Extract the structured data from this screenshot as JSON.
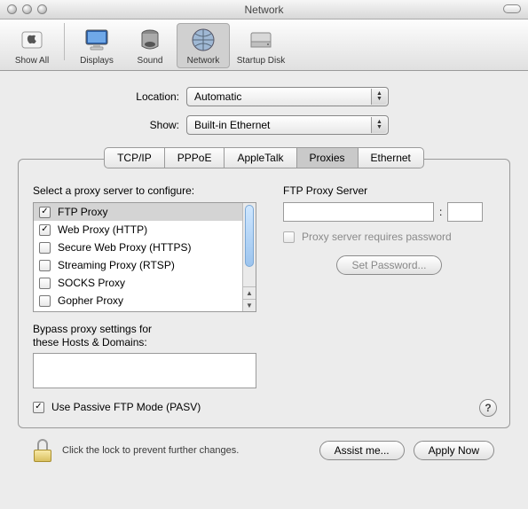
{
  "window": {
    "title": "Network"
  },
  "toolbar": {
    "items": [
      {
        "label": "Show All",
        "icon": "apple-icon",
        "selected": false
      },
      {
        "label": "Displays",
        "icon": "display-icon",
        "selected": false
      },
      {
        "label": "Sound",
        "icon": "speaker-icon",
        "selected": false
      },
      {
        "label": "Network",
        "icon": "globe-icon",
        "selected": true
      },
      {
        "label": "Startup Disk",
        "icon": "drive-icon",
        "selected": false
      }
    ]
  },
  "location_label": "Location:",
  "location_value": "Automatic",
  "show_label": "Show:",
  "show_value": "Built-in Ethernet",
  "tabs": [
    {
      "label": "TCP/IP",
      "selected": false
    },
    {
      "label": "PPPoE",
      "selected": false
    },
    {
      "label": "AppleTalk",
      "selected": false
    },
    {
      "label": "Proxies",
      "selected": true
    },
    {
      "label": "Ethernet",
      "selected": false
    }
  ],
  "proxies": {
    "select_label": "Select a proxy server to configure:",
    "items": [
      {
        "label": "FTP Proxy",
        "checked": true,
        "selected": true
      },
      {
        "label": "Web Proxy (HTTP)",
        "checked": true,
        "selected": false
      },
      {
        "label": "Secure Web Proxy (HTTPS)",
        "checked": false,
        "selected": false
      },
      {
        "label": "Streaming Proxy (RTSP)",
        "checked": false,
        "selected": false
      },
      {
        "label": "SOCKS Proxy",
        "checked": false,
        "selected": false
      },
      {
        "label": "Gopher Proxy",
        "checked": false,
        "selected": false
      }
    ],
    "server_label": "FTP Proxy Server",
    "host_value": "",
    "port_value": "",
    "requires_password_label": "Proxy server requires password",
    "requires_password_checked": false,
    "set_password_label": "Set Password...",
    "bypass_label_line1": "Bypass proxy settings for",
    "bypass_label_line2": "these Hosts & Domains:",
    "bypass_value": "",
    "pasv_label": "Use Passive FTP Mode (PASV)",
    "pasv_checked": true,
    "help_label": "?"
  },
  "footer": {
    "lock_text": "Click the lock to prevent further changes.",
    "assist_label": "Assist me...",
    "apply_label": "Apply Now"
  }
}
